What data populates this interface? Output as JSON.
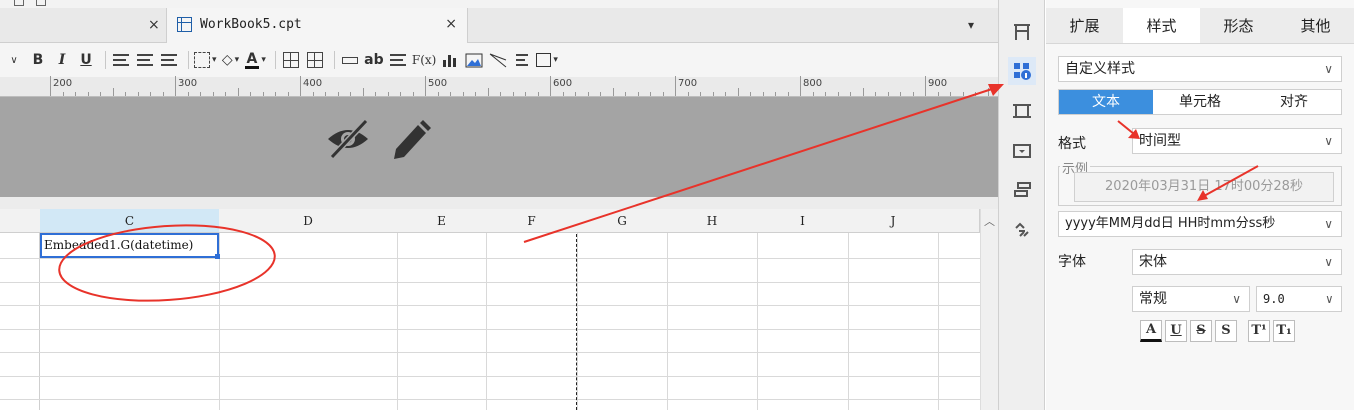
{
  "tabs": {
    "previous_close": "×",
    "active_title": "WorkBook5.cpt",
    "active_close": "×",
    "menu_glyph": "▾"
  },
  "toolbar": {
    "bold": "B",
    "italic": "I",
    "underline": "U",
    "font_color": "A",
    "label_ab": "ab",
    "formula": "F(x)"
  },
  "ruler": {
    "labels": [
      "200",
      "300",
      "400",
      "500",
      "600",
      "700",
      "800",
      "900"
    ]
  },
  "grid": {
    "columns": [
      "C",
      "D",
      "E",
      "F",
      "G",
      "H",
      "I",
      "J"
    ],
    "selected_cell_value": "Embedded1.G(datetime)"
  },
  "panel": {
    "tabs": [
      "扩展",
      "样式",
      "形态",
      "其他"
    ],
    "active_tab": "样式",
    "style_select": "自定义样式",
    "sub_tabs": [
      "文本",
      "单元格",
      "对齐"
    ],
    "format_label": "格式",
    "format_value": "时间型",
    "example_title": "示例",
    "example_value": "2020年03月31日 17时00分28秒",
    "pattern_value": "yyyy年MM月dd日 HH时mm分ss秒",
    "font_label": "字体",
    "font_value": "宋体",
    "font_style": "常规",
    "font_size": "9.0",
    "text_buttons": [
      "A",
      "U",
      "S",
      "S",
      "T¹",
      "T₁"
    ]
  },
  "colors": {
    "accent": "#3c8fde",
    "selection_border": "#2f6fd6",
    "annotation": "#e8332a",
    "header_band": "#a4a4a4"
  },
  "icons": [
    "tab-workbook-icon",
    "eye-off-icon",
    "pencil-icon",
    "cell-attribute-icon",
    "widget-settings-icon",
    "border-icon",
    "dropdown-icon",
    "condition-icon",
    "hyperlink-icon"
  ]
}
